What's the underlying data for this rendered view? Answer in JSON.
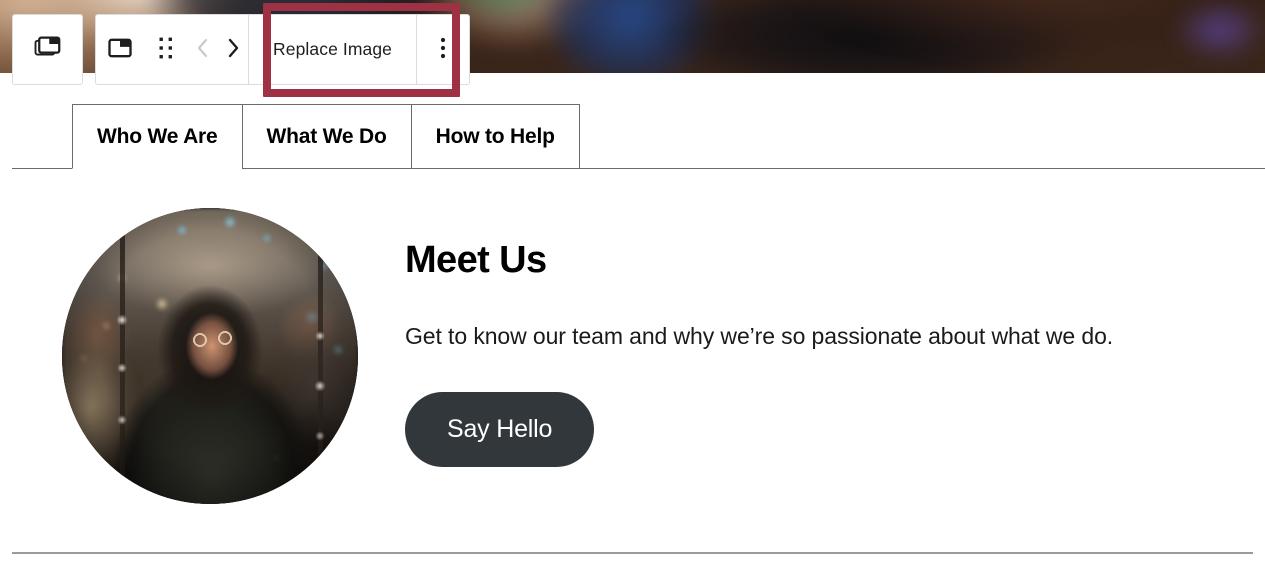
{
  "toolbar": {
    "parent_block": {
      "icon": "select-parent-block-icon",
      "tooltip": "Select parent block"
    },
    "block_type": {
      "icon": "image-block-icon",
      "tooltip": "Image"
    },
    "drag": {
      "icon": "drag-handle-icon",
      "tooltip": "Drag"
    },
    "move_prev": {
      "icon": "chevron-left-icon",
      "tooltip": "Move left",
      "state": "disabled"
    },
    "move_next": {
      "icon": "chevron-right-icon",
      "tooltip": "Move right",
      "state": "enabled"
    },
    "replace_label": "Replace Image",
    "more_options": {
      "icon": "more-vertical-icon",
      "tooltip": "Options"
    }
  },
  "highlight": {
    "target": "Replace Image",
    "color": "#9e3244"
  },
  "tabs": [
    {
      "label": "Who We Are",
      "active": true
    },
    {
      "label": "What We Do",
      "active": false
    },
    {
      "label": "How to Help",
      "active": false
    }
  ],
  "panel": {
    "avatar_alt": "Smiling person wearing glasses at a night festival with bokeh lights",
    "title": "Meet Us",
    "description": "Get to know our team and why we’re so passionate about what we do.",
    "cta_label": "Say Hello",
    "cta_color": "#32373c"
  }
}
